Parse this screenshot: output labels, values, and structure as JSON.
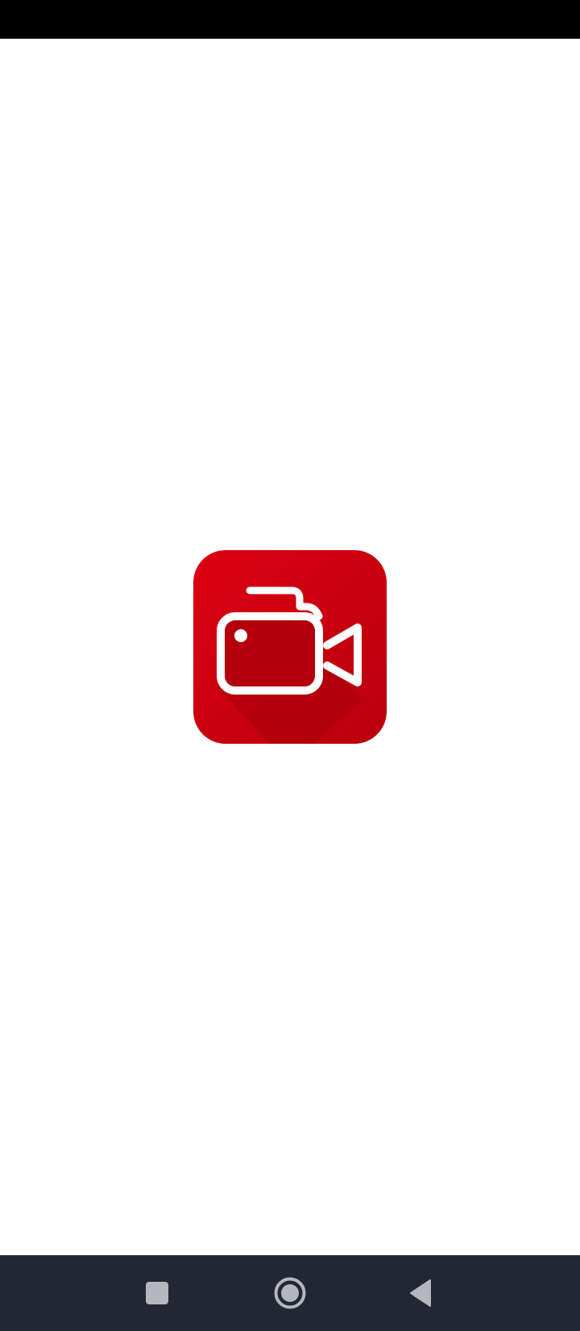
{
  "app": {
    "logo_icon": "video-camera-icon",
    "brand_color": "#d0000f",
    "brand_color_dark": "#a8000c"
  },
  "system": {
    "status_bar_color": "#000000",
    "nav_bar_color": "#222833",
    "nav_buttons": [
      {
        "name": "recents",
        "icon": "square-icon"
      },
      {
        "name": "home",
        "icon": "circle-icon"
      },
      {
        "name": "back",
        "icon": "triangle-back-icon"
      }
    ]
  }
}
